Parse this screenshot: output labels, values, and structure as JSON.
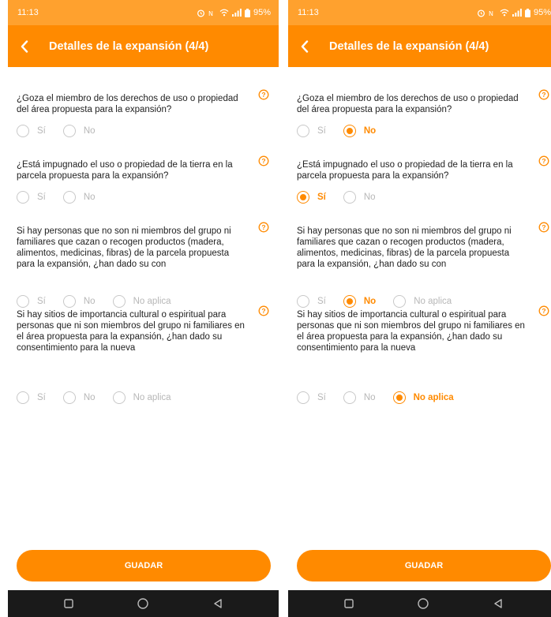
{
  "accent_color": "#FF8A00",
  "status_bar": {
    "time": "11:13",
    "battery": "95%"
  },
  "screens": [
    {
      "header_title": "Detalles de la expansión (4/4)",
      "questions": [
        {
          "text": "¿Goza el miembro de los derechos de uso o propiedad del área propuesta para la expansión?",
          "options": [
            "Sí",
            "No"
          ],
          "selected": null
        },
        {
          "text": "¿Está impugnado el uso o propiedad de la tierra en la parcela propuesta para la expansión?",
          "options": [
            "Sí",
            "No"
          ],
          "selected": null
        },
        {
          "text": "Si hay personas que no son ni miembros del grupo ni familiares que cazan o recogen productos (madera, alimentos, medicinas, fibras) de la parcela propuesta para la expansión, ¿han dado su con",
          "options": [
            "Sí",
            "No",
            "No aplica"
          ],
          "selected": null
        },
        {
          "text": "Si hay sitios de importancia cultural o espiritual para personas que ni son miembros del grupo ni familiares en el área propuesta para la expansión, ¿han dado su consentimiento para la nueva",
          "options": [
            "Sí",
            "No",
            "No aplica"
          ],
          "selected": null
        }
      ],
      "save_label": "GUADAR"
    },
    {
      "header_title": "Detalles de la expansión (4/4)",
      "questions": [
        {
          "text": "¿Goza el miembro de los derechos de uso o propiedad del área propuesta para la expansión?",
          "options": [
            "Sí",
            "No"
          ],
          "selected": "No"
        },
        {
          "text": "¿Está impugnado el uso o propiedad de la tierra en la parcela propuesta para la expansión?",
          "options": [
            "Sí",
            "No"
          ],
          "selected": "Sí"
        },
        {
          "text": "Si hay personas que no son ni miembros del grupo ni familiares que cazan o recogen productos (madera, alimentos, medicinas, fibras) de la parcela propuesta para la expansión, ¿han dado su con",
          "options": [
            "Sí",
            "No",
            "No aplica"
          ],
          "selected": "No"
        },
        {
          "text": "Si hay sitios de importancia cultural o espiritual para personas que ni son miembros del grupo ni familiares en el área propuesta para la expansión, ¿han dado su consentimiento para la nueva",
          "options": [
            "Sí",
            "No",
            "No aplica"
          ],
          "selected": "No aplica"
        }
      ],
      "save_label": "GUADAR"
    }
  ]
}
